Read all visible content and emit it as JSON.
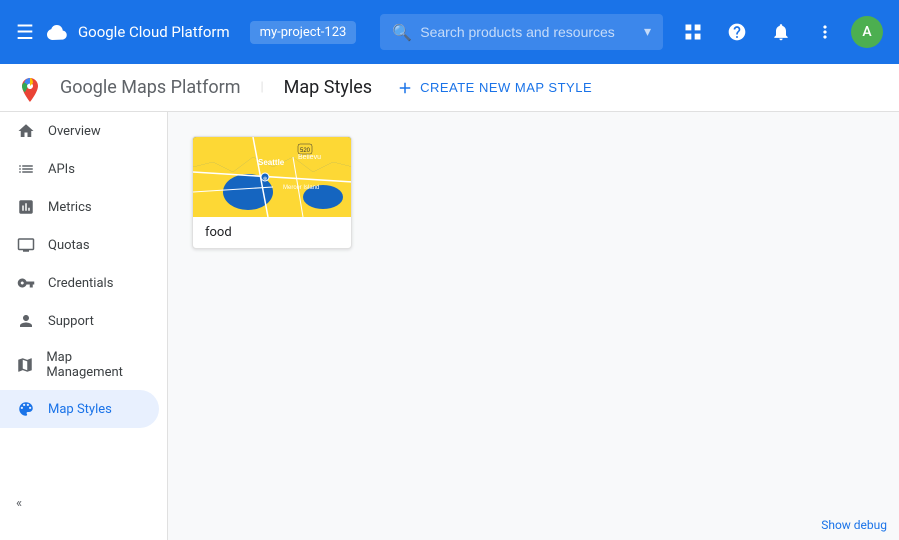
{
  "topNav": {
    "menuIcon": "☰",
    "appName": "Google Cloud Platform",
    "accountLabel": "my-project-123",
    "searchPlaceholder": "Search products and resources",
    "dropdownIcon": "▾",
    "icons": {
      "grid": "⊞",
      "help": "?",
      "bell": "🔔",
      "more": "⋮"
    },
    "avatarInitial": "A"
  },
  "subheader": {
    "appName": "Google Maps Platform",
    "separator": "|",
    "pageTitle": "Map Styles",
    "createButton": "CREATE NEW MAP STYLE",
    "createIcon": "+"
  },
  "sidebar": {
    "items": [
      {
        "id": "overview",
        "label": "Overview",
        "icon": "home"
      },
      {
        "id": "apis",
        "label": "APIs",
        "icon": "list"
      },
      {
        "id": "metrics",
        "label": "Metrics",
        "icon": "chart"
      },
      {
        "id": "quotas",
        "label": "Quotas",
        "icon": "monitor"
      },
      {
        "id": "credentials",
        "label": "Credentials",
        "icon": "key"
      },
      {
        "id": "support",
        "label": "Support",
        "icon": "person"
      },
      {
        "id": "map-management",
        "label": "Map Management",
        "icon": "map"
      },
      {
        "id": "map-styles",
        "label": "Map Styles",
        "icon": "palette",
        "active": true
      }
    ]
  },
  "mapStyles": {
    "cards": [
      {
        "id": "food",
        "label": "food"
      }
    ]
  },
  "footer": {
    "debugLink": "Show debug"
  },
  "collapseIcon": "«"
}
